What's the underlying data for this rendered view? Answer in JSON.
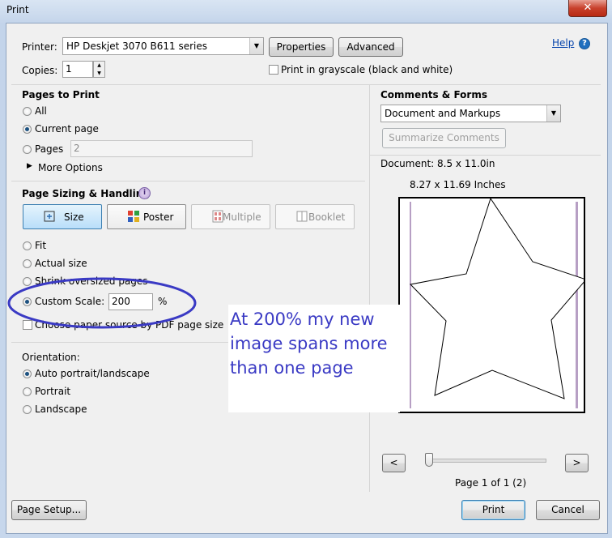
{
  "window": {
    "title": "Print",
    "close_glyph": "✕"
  },
  "help_link": "Help",
  "printer": {
    "label": "Printer:",
    "selected": "HP Deskjet 3070 B611 series",
    "properties_button": "Properties",
    "advanced_button": "Advanced"
  },
  "copies": {
    "label": "Copies:",
    "value": "1"
  },
  "grayscale": {
    "label": "Print in grayscale (black and white)",
    "checked": false
  },
  "pages_to_print": {
    "heading": "Pages to Print",
    "options": [
      {
        "label": "All",
        "selected": false
      },
      {
        "label": "Current page",
        "selected": true
      },
      {
        "label": "Pages",
        "selected": false
      }
    ],
    "pages_value": "2",
    "more_options": "More Options"
  },
  "page_sizing": {
    "heading": "Page Sizing & Handling",
    "info_glyph": "i",
    "tabs": [
      {
        "label": "Size",
        "state": "active"
      },
      {
        "label": "Poster",
        "state": "normal"
      },
      {
        "label": "Multiple",
        "state": "disabled"
      },
      {
        "label": "Booklet",
        "state": "disabled"
      }
    ],
    "options": [
      {
        "label": "Fit",
        "selected": false
      },
      {
        "label": "Actual size",
        "selected": false
      },
      {
        "label": "Shrink oversized pages",
        "selected": false
      },
      {
        "label": "Custom Scale:",
        "selected": true
      }
    ],
    "custom_scale_value": "200",
    "percent_sign": "%",
    "paper_source_label": "Choose paper source by PDF page size",
    "paper_source_checked": false
  },
  "orientation": {
    "heading": "Orientation:",
    "options": [
      {
        "label": "Auto portrait/landscape",
        "selected": true
      },
      {
        "label": "Portrait",
        "selected": false
      },
      {
        "label": "Landscape",
        "selected": false
      }
    ]
  },
  "annotation": {
    "text": "At 200% my new image spans more than one page",
    "line1": "At 200% my new",
    "line2": "image spans more",
    "line3": "than one page",
    "color": "#3a3ac4"
  },
  "comments_forms": {
    "heading": "Comments & Forms",
    "selected": "Document and Markups",
    "summarize_button": "Summarize Comments"
  },
  "preview": {
    "document_size": "Document: 8.5 x 11.0in",
    "paper_size": "8.27 x 11.69 Inches",
    "prev_glyph": "<",
    "next_glyph": ">",
    "page_indicator": "Page 1 of 1 (2)",
    "slider_position": 0
  },
  "footer": {
    "page_setup_button": "Page Setup...",
    "print_button": "Print",
    "cancel_button": "Cancel"
  }
}
